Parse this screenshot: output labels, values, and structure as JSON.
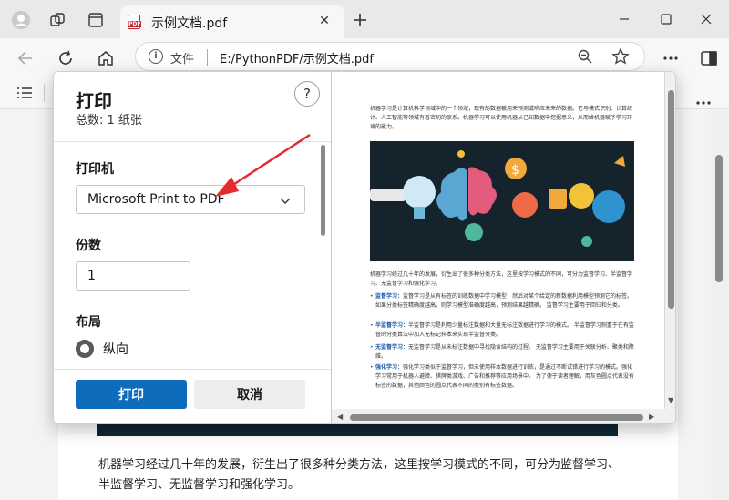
{
  "browser": {
    "tab_title": "示例文档.pdf",
    "tab_close": "✕",
    "address_label": "文件",
    "address_url": "E:/PythonPDF/示例文档.pdf"
  },
  "background_page": {
    "paragraph": "机器学习经过几十年的发展，衍生出了很多种分类方法，这里按学习模式的不同，可分为监督学习、半监督学习、无监督学习和强化学习。"
  },
  "print_dialog": {
    "title": "打印",
    "subtitle": "总数: 1 纸张",
    "help": "?",
    "printer_label": "打印机",
    "printer_value": "Microsoft Print to PDF",
    "copies_label": "份数",
    "copies_value": "1",
    "layout_label": "布局",
    "layout_option": "纵向",
    "print_button": "打印",
    "cancel_button": "取消"
  },
  "preview": {
    "intro": "机器学习是计算机科学领域中的一个领域，现有的数据被用来预测或响应未来的数据。它与模式识别、计算统计、人工智能等领域有着密切的联系。机器学习可以使用机器从已知数据中挖掘意义，从而给机器赋予学习环境的能力。",
    "para2": "机器学习经过几十年的发展，衍生出了很多种分类方法，这里按学习模式的不同，可分为监督学习、半监督学习、无监督学习和强化学习。",
    "items": [
      {
        "term": "监督学习：",
        "text": "监督学习是从有标签的训练数据中学习模型，然后对某个给定的新数据利用模型预测它的标签。如果分类标签精确度越高，则学习模型准确度越高，预测结果越精确。 监督学习主要用于回归和分类。"
      },
      {
        "term": "半监督学习：",
        "text": "半监督学习是利用少量标注数据和大量无标注数据进行学习的模式。 半监督学习侧重于在有监督的分类算法中加入无标记样本来实现半监督分类。"
      },
      {
        "term": "无监督学习：",
        "text": "无监督学习是从未标注数据中寻找隐含结构的过程。 无监督学习主要用于关联分析、聚类和降维。"
      },
      {
        "term": "强化学习：",
        "text": "强化学习类似于监督学习，但未使用样本数据进行训练，是通过不断试错进行学习的模式。强化学习常用于机器人避障、棋牌类游戏、广告和推荐等应用场景中。 为了便于读者理解，用灰色圆点代表没有标签的数据，其他颜色的圆点代表不同的类别有标签数据。"
      }
    ]
  },
  "colors": {
    "accent": "#0f6cbd",
    "arrow": "#e52b2b",
    "illustration_bg": "#14232c"
  }
}
